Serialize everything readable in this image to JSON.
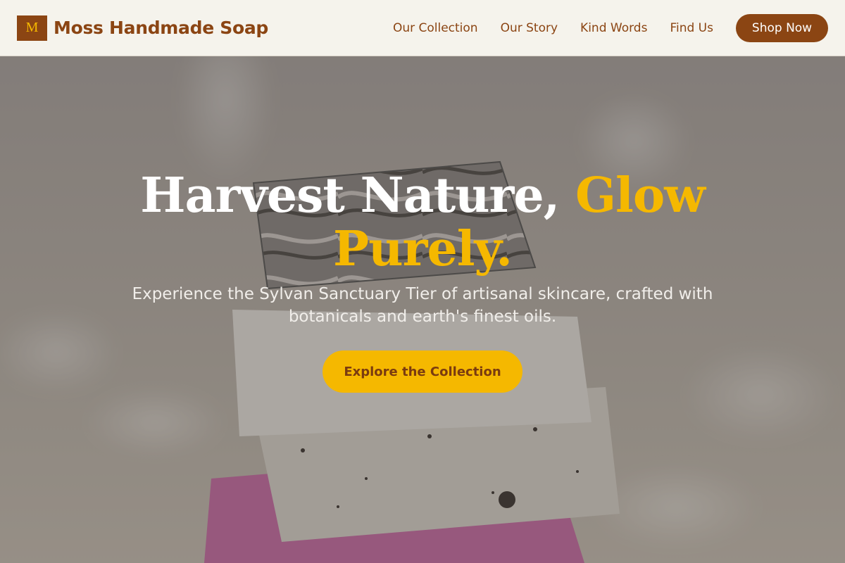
{
  "header": {
    "logo_letter": "M",
    "brand_name": "Moss Handmade Soap",
    "nav": [
      {
        "label": "Our Collection"
      },
      {
        "label": "Our Story"
      },
      {
        "label": "Kind Words"
      },
      {
        "label": "Find Us"
      }
    ],
    "shop_button": "Shop Now"
  },
  "hero": {
    "title_main": "Harvest Nature, ",
    "title_accent": "Glow Purely.",
    "subtitle": "Experience the Sylvan Sanctuary Tier of artisanal skincare, crafted with botanicals and earth's finest oils.",
    "cta_label": "Explore the Collection",
    "image_subject": "stacked-handmade-soap-bars"
  },
  "colors": {
    "brand_brown": "#8b4513",
    "accent_gold": "#f5b800",
    "header_bg": "#f5f3ec"
  }
}
